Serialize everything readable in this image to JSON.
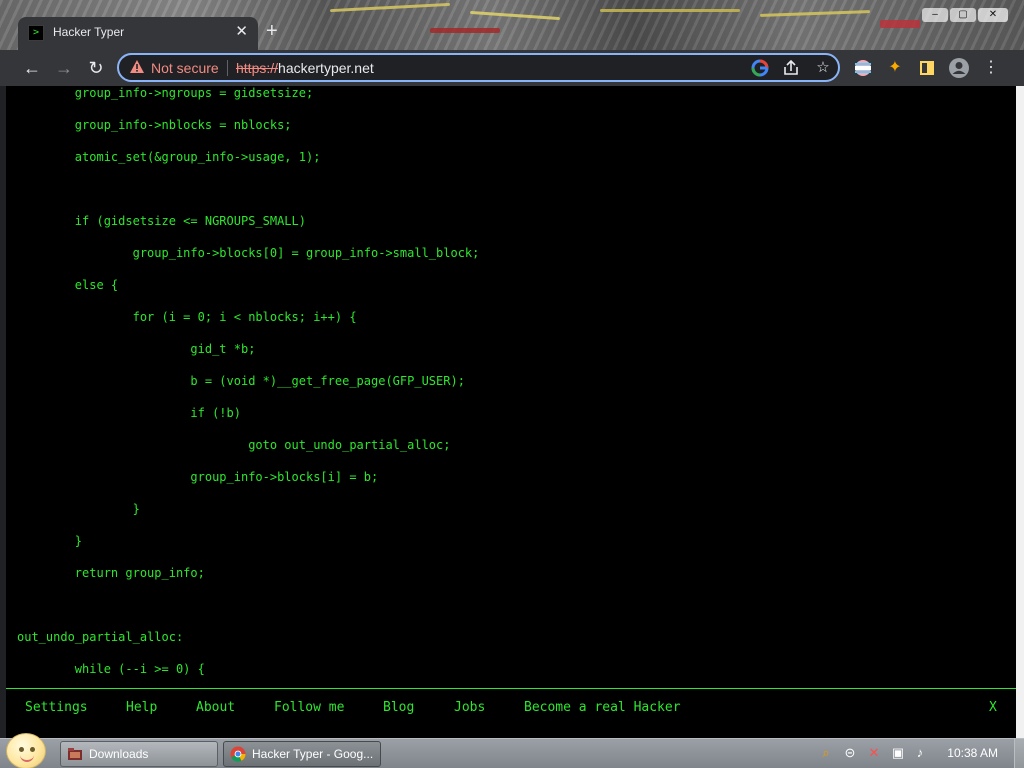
{
  "browser": {
    "tab": {
      "title": "Hacker Typer",
      "favicon": "terminal-icon",
      "favicon_glyph": ">"
    },
    "omnibox": {
      "security_text": "Not secure",
      "url_scheme": "https://",
      "url_host": "hackertyper.net"
    },
    "icons": [
      "back-arrow-icon",
      "forward-arrow-icon",
      "reload-icon",
      "google-lens-icon",
      "share-icon",
      "bookmark-star-icon",
      "profile-flag-icon",
      "extensions-puzzle-icon",
      "side-panel-icon",
      "account-avatar-icon",
      "kebab-menu-icon"
    ]
  },
  "page": {
    "code_color": "#2ee62e",
    "background": "#000000",
    "code_lines": [
      "        group_info->ngroups = gidsetsize;",
      "",
      "        group_info->nblocks = nblocks;",
      "",
      "        atomic_set(&group_info->usage, 1);",
      "",
      "",
      "",
      "        if (gidsetsize <= NGROUPS_SMALL)",
      "",
      "                group_info->blocks[0] = group_info->small_block;",
      "",
      "        else {",
      "",
      "                for (i = 0; i < nblocks; i++) {",
      "",
      "                        gid_t *b;",
      "",
      "                        b = (void *)__get_free_page(GFP_USER);",
      "",
      "                        if (!b)",
      "",
      "                                goto out_undo_partial_alloc;",
      "",
      "                        group_info->blocks[i] = b;",
      "",
      "                }",
      "",
      "        }",
      "",
      "        return group_info;",
      "",
      "",
      "",
      "out_undo_partial_alloc:",
      "",
      "        while (--i >= 0) {"
    ],
    "menu": [
      "Settings",
      "Help",
      "About",
      "Follow me",
      "Blog",
      "Jobs",
      "Become a real Hacker"
    ],
    "menu_close": "X"
  },
  "taskbar": {
    "buttons": [
      {
        "label": "Downloads",
        "icon": "folder-downloads-icon"
      },
      {
        "label": "Hacker Typer - Goog...",
        "icon": "chrome-icon"
      }
    ],
    "tray_icons": [
      "search-magnifier-icon",
      "minimize-tray-icon",
      "network-error-icon",
      "power-icon",
      "volume-icon"
    ],
    "clock": "10:38 AM"
  }
}
